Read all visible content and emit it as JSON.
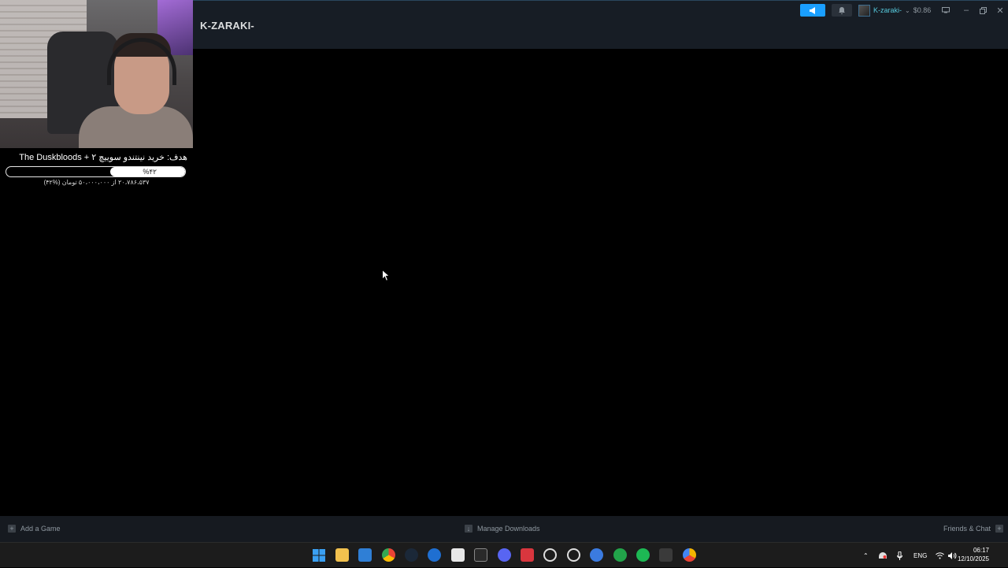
{
  "steam": {
    "title": "K-ZARAKI-",
    "username": "K-zaraki-",
    "wallet": "$0.86",
    "bottom": {
      "add_game": "Add a Game",
      "manage_downloads": "Manage Downloads",
      "friends_chat": "Friends & Chat"
    }
  },
  "overlay": {
    "goal_title": "هدف: خرید نینتندو سوییچ ۲ + The Duskbloods",
    "goal_percent": "%۴۲",
    "goal_progress": 0.42,
    "goal_amount": "۲۰،۷۸۶،۵۳۷ از ۵۰،۰۰۰،۰۰۰ تومان (%۴۲)"
  },
  "taskbar": {
    "icons": [
      "windows-start-icon",
      "file-explorer-icon",
      "photos-icon",
      "chrome-icon",
      "steam-icon",
      "edge-dev-icon",
      "store-icon",
      "epic-games-icon",
      "discord-icon",
      "game-launcher-icon",
      "chatgpt-icon",
      "obs-icon",
      "web-icon",
      "xbox-icon",
      "spotify-icon",
      "terminal-icon",
      "chrome-canary-icon"
    ],
    "language": "ENG",
    "time": "06:17",
    "date": "12/10/2025"
  },
  "colors": {
    "steam_header": "#171d25",
    "steam_accent": "#1a9fff",
    "username_color": "#57cbde",
    "taskbar": "#1c1c1c"
  }
}
